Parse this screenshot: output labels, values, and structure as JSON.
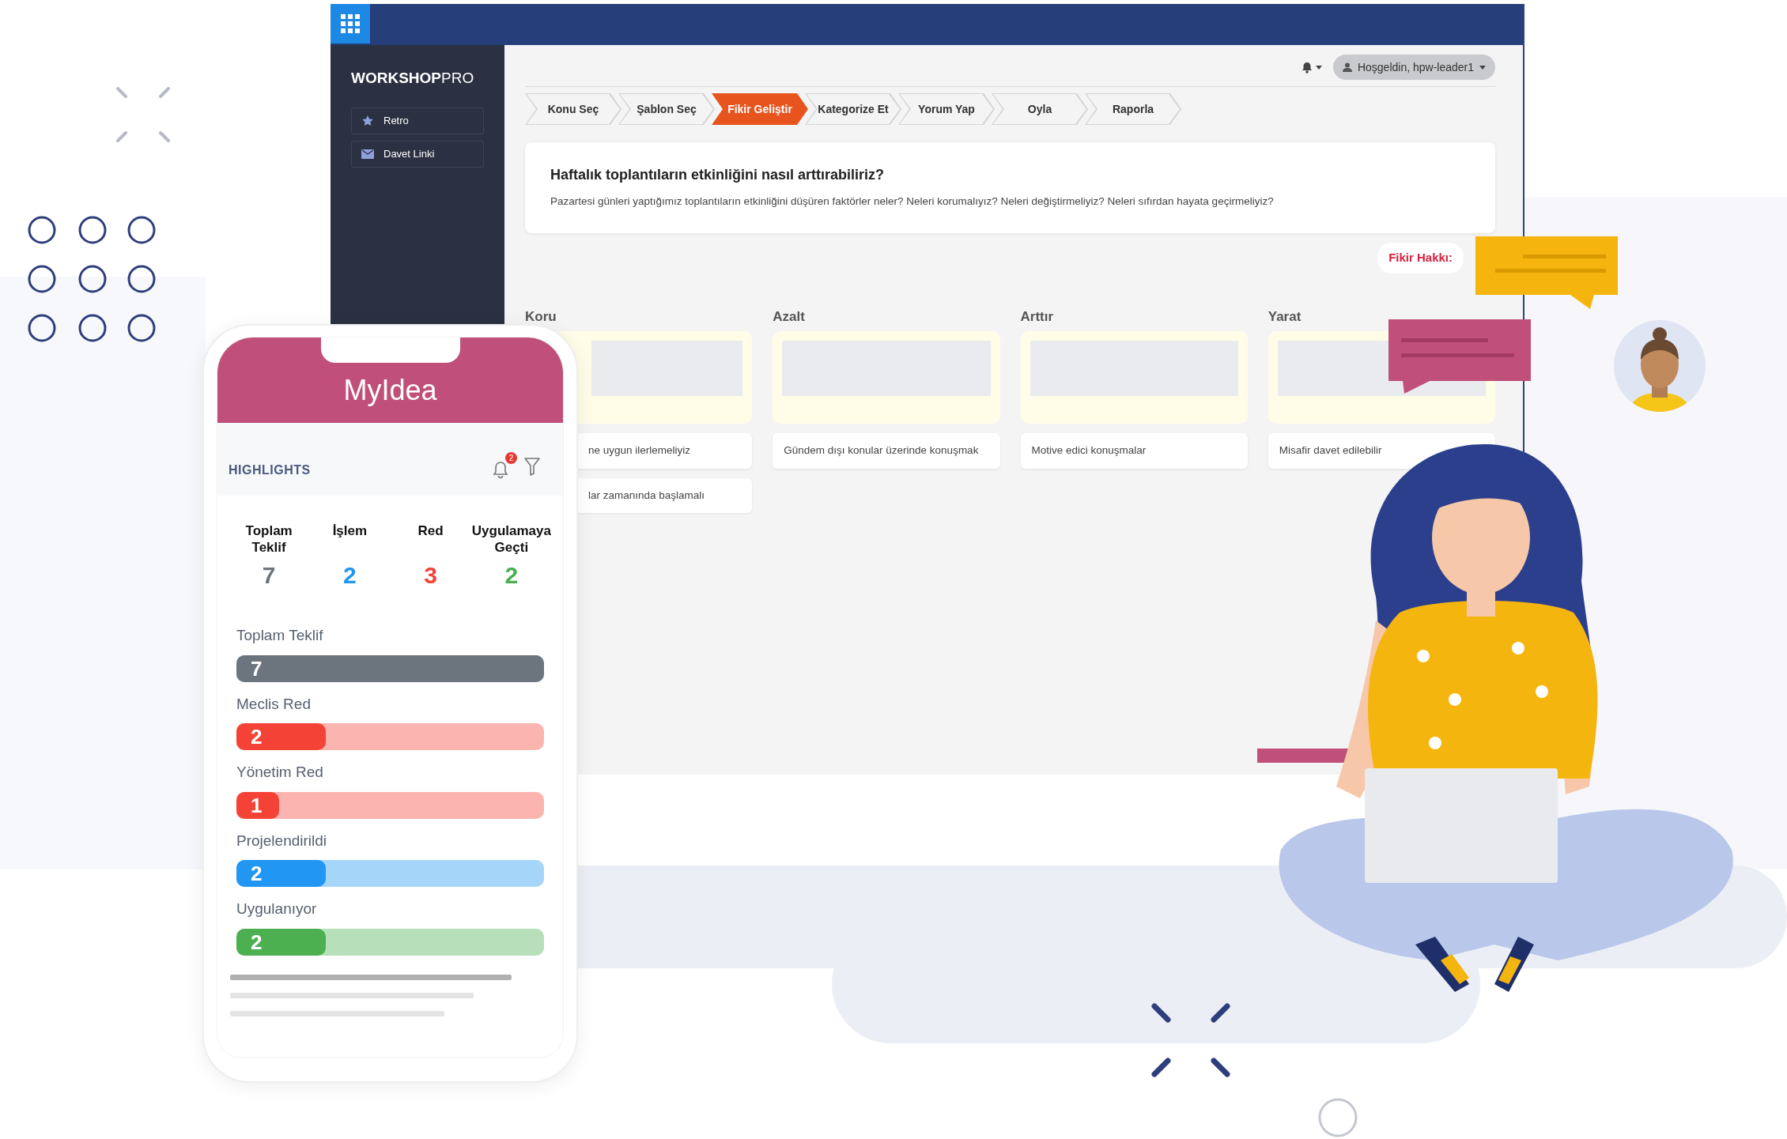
{
  "app": {
    "brand": "**WORKSHOP**PRO",
    "sidebar": [
      {
        "label": "Retro"
      },
      {
        "label": "Davet Linki"
      }
    ],
    "user_menu": "Hoşgeldin, hpw-leader1",
    "steps": [
      {
        "label": "Konu Seç",
        "selected": false
      },
      {
        "label": "Şablon Seç",
        "selected": false
      },
      {
        "label": "Fikir Geliştir",
        "selected": true
      },
      {
        "label": "Kategorize Et",
        "selected": false
      },
      {
        "label": "Yorum Yap",
        "selected": false
      },
      {
        "label": "Oyla",
        "selected": false
      },
      {
        "label": "Raporla",
        "selected": false
      }
    ],
    "question": {
      "title": "Haftalık toplantıların etkinliğini nasıl arttırabiliriz?",
      "description": "Pazartesi günleri yaptığımız toplantıların etkinliğini düşüren faktörler neler? Neleri korumalıyız? Neleri değiştirmeliyiz? Neleri sıfırdan hayata geçirmeliyiz?"
    },
    "idea_quota": "Fikir Hakkı:",
    "columns": [
      {
        "title": "Koru",
        "ideas": [
          "ne uygun ilerlemeliyiz",
          "lar zamanında başlamalı"
        ]
      },
      {
        "title": "Azalt",
        "ideas": [
          "Gündem dışı konular üzerinde konuşmak"
        ]
      },
      {
        "title": "Arttır",
        "ideas": [
          "Motive edici konuşmalar"
        ]
      },
      {
        "title": "Yarat",
        "ideas": [
          "Misafir davet edilebilir"
        ]
      }
    ]
  },
  "phone": {
    "title": "MyIdea",
    "section": "HIGHLIGHTS",
    "notifications": "2",
    "stats": [
      {
        "label": "Toplam Teklif",
        "value": "7",
        "color": "#6c757d"
      },
      {
        "label": "İşlem",
        "value": "2",
        "color": "#2196f3"
      },
      {
        "label": "Red",
        "value": "3",
        "color": "#f44336"
      },
      {
        "label": "Uygulamaya Geçti",
        "value": "2",
        "color": "#4caf50"
      }
    ],
    "bars": [
      {
        "label": "Toplam Teklif",
        "value": "7",
        "level": 1,
        "color": "#6c757d"
      },
      {
        "label": "Meclis Red",
        "value": "2",
        "level": 0.29,
        "color": "#f44336"
      },
      {
        "label": "Yönetim Red",
        "value": "1",
        "level": 0.14,
        "color": "#f44336"
      },
      {
        "label": "Projelendirildi",
        "value": "2",
        "level": 0.29,
        "color": "#2196f3"
      },
      {
        "label": "Uygulanıyor",
        "value": "2",
        "level": 0.29,
        "color": "#4caf50"
      }
    ]
  }
}
